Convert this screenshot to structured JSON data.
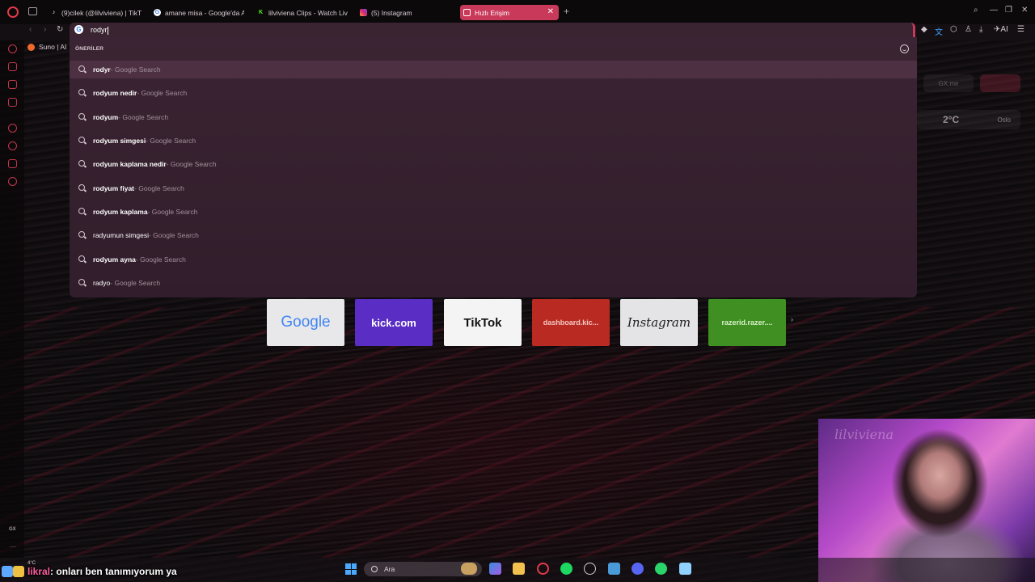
{
  "tabs": [
    {
      "label": "(9)cilek (@lilviviena) | TikT",
      "icon": "tiktok-icon"
    },
    {
      "label": "amane misa - Google'da A",
      "icon": "google-icon"
    },
    {
      "label": "lilviviena Clips - Watch Liv",
      "icon": "kick-icon"
    },
    {
      "label": "(5) Instagram",
      "icon": "instagram-icon"
    },
    {
      "label": "Hızlı Erişim",
      "icon": "speed-dial-icon",
      "active": true
    }
  ],
  "address_bar": {
    "value": "rodyr"
  },
  "bookmark": {
    "label": "Suno | AI"
  },
  "suggestions": {
    "header": "ÖNERİLER",
    "source_suffix": " - Google Search",
    "items": [
      {
        "term": "rodyr",
        "selected": true
      },
      {
        "term": "rodyum nedir"
      },
      {
        "term": "rodyum"
      },
      {
        "term": "rodyum simgesi"
      },
      {
        "term": "rodyum kaplama nedir"
      },
      {
        "term": "rodyum fiyat"
      },
      {
        "term": "rodyum kaplama"
      },
      {
        "term": "radyumun simgesi"
      },
      {
        "term": "rodyum ayna"
      },
      {
        "term": "radyo"
      }
    ]
  },
  "widgets": {
    "gx_label": "GX.me",
    "temperature": "2°C",
    "city": "Oslo"
  },
  "speed_dials": [
    {
      "label": "Google",
      "color": "#e8e8ea"
    },
    {
      "label": "kick.com",
      "color": "#5a2ec4"
    },
    {
      "label": "TikTok",
      "color": "#f4f4f4"
    },
    {
      "label": "dashboard.kic...",
      "color": "#b92a22"
    },
    {
      "label": "Instagram",
      "color": "#e4e4e6"
    },
    {
      "label": "razerid.razer....",
      "color": "#3f8f22"
    }
  ],
  "sidebar": {
    "gx_label": "GX"
  },
  "chat": {
    "username": "likral",
    "message": ": onları ben tanımıyorum ya"
  },
  "taskbar": {
    "search_label": "Ara",
    "temperature": "4°C"
  },
  "webcam": {
    "overlay_text": "lilviviena"
  }
}
